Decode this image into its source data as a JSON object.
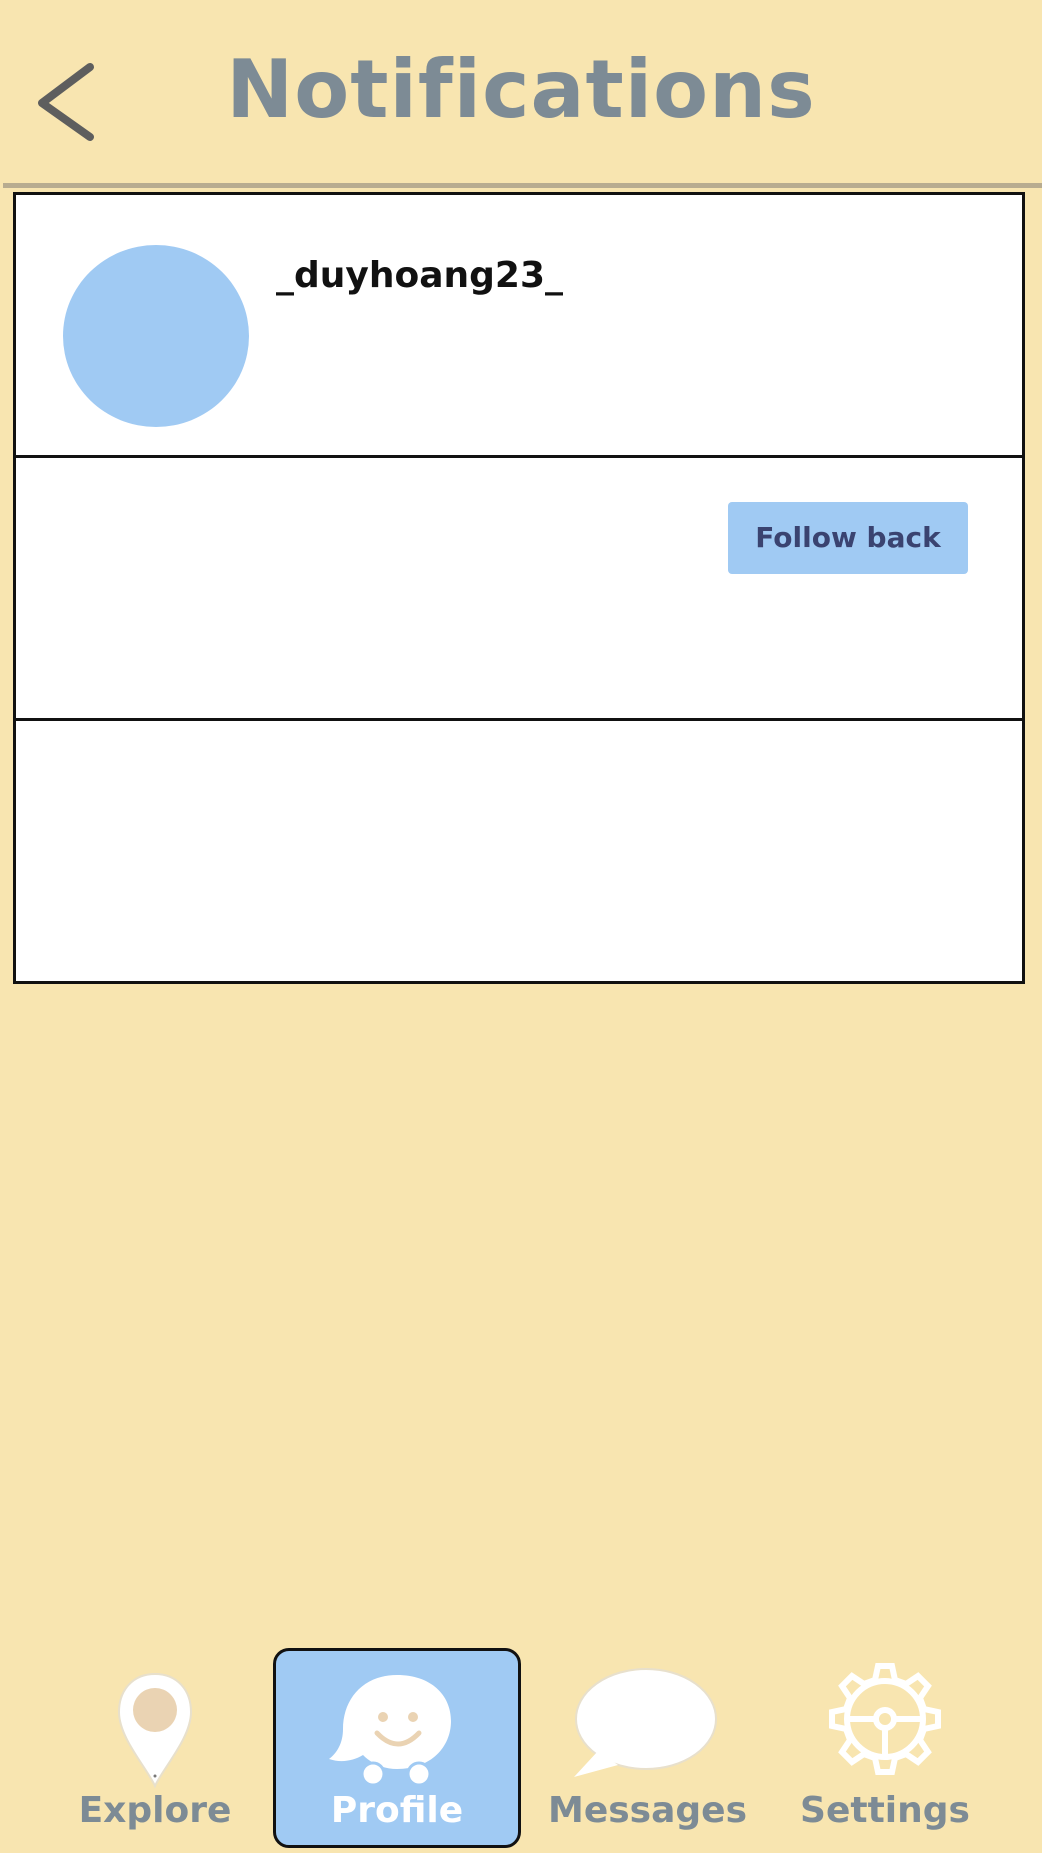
{
  "header": {
    "title": "Notifications",
    "back_icon": "chevron-left-icon"
  },
  "notifications": [
    {
      "username": "_duyhoang23_",
      "action_label": "Follow back"
    }
  ],
  "nav": {
    "items": [
      {
        "label": "Explore",
        "icon": "map-pin-icon",
        "active": false
      },
      {
        "label": "Profile",
        "icon": "smiley-bubble-icon",
        "active": true
      },
      {
        "label": "Messages",
        "icon": "speech-bubble-icon",
        "active": false
      },
      {
        "label": "Settings",
        "icon": "gear-icon",
        "active": false
      }
    ]
  },
  "colors": {
    "background": "#F8E5B0",
    "accent": "#A0CAF3",
    "title": "#7D8B95",
    "button_text": "#3A4370"
  }
}
